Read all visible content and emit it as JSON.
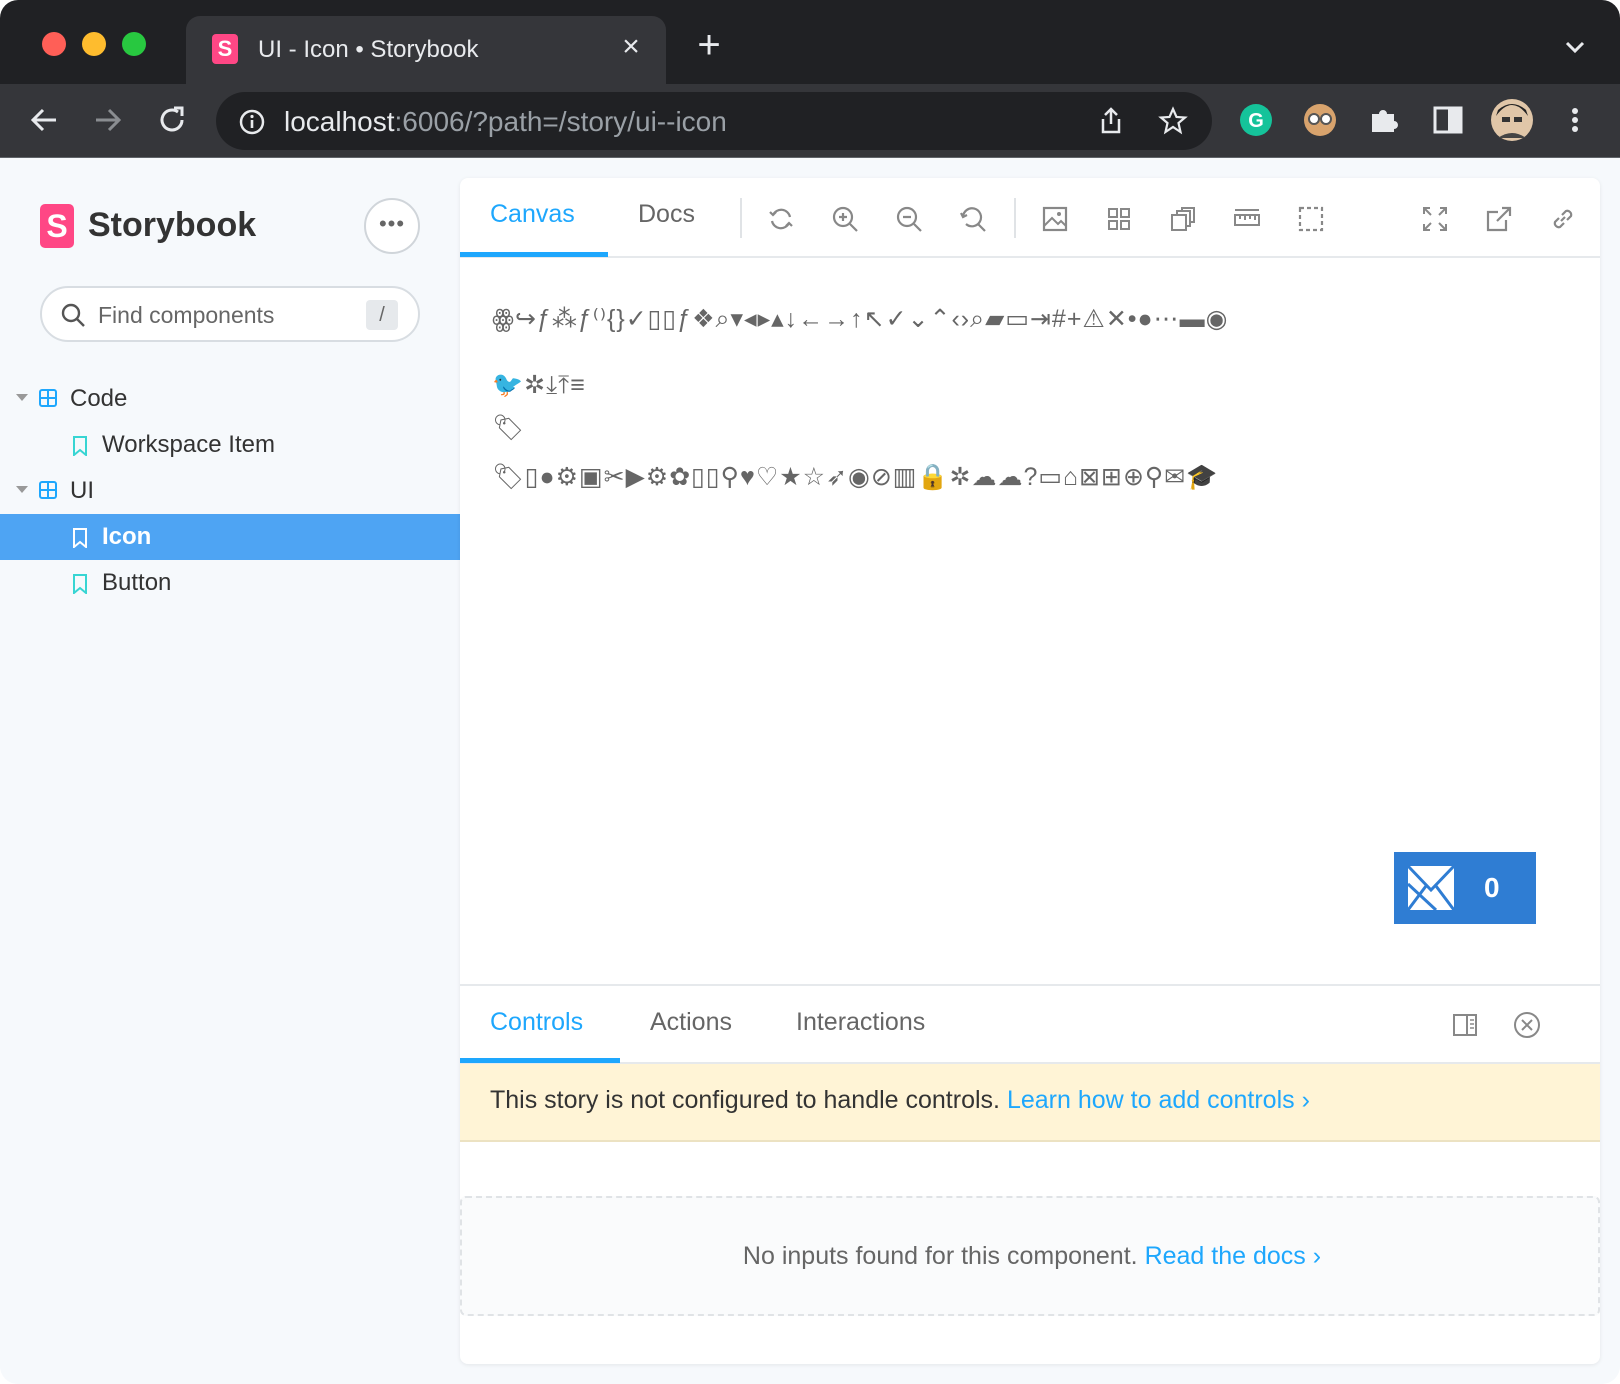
{
  "browser": {
    "tab_title": "UI - Icon • Storybook",
    "tab_favicon": "S",
    "new_tab": "+",
    "url_host": "localhost",
    "url_rest": ":6006/?path=/story/ui--icon"
  },
  "sidebar": {
    "logo_text": "Storybook",
    "logo_letter": "S",
    "menu_label": "•••",
    "search_placeholder": "Find components",
    "search_shortcut": "/",
    "tree": [
      {
        "label": "Code",
        "type": "group"
      },
      {
        "label": "Workspace Item",
        "type": "story"
      },
      {
        "label": "UI",
        "type": "group"
      },
      {
        "label": "Icon",
        "type": "story",
        "active": true
      },
      {
        "label": "Button",
        "type": "story"
      }
    ]
  },
  "main": {
    "tabs": {
      "canvas": "Canvas",
      "docs": "Docs"
    },
    "icon_rows": {
      "row1": "ꙮ↪ƒ⁂ƒ⁽⁾{}✓▯▯ƒ❖⌕▾◂▸▴↓←→↑↖✓⌄⌃‹›⌕▰▭⇥#+⚠✕•●⋯▬◉",
      "row2": "🐦✲⤓⤒≡",
      "row3": "🏷",
      "row4": "🏷▯●⚙▣✂▶⚙✿▯▯⚲♥♡★☆➶◉⊘▥🔒✲☁☁?▭⌂⊠⊞⊕⚲✉🎓"
    },
    "counter_value": "0"
  },
  "addons": {
    "tabs": {
      "controls": "Controls",
      "actions": "Actions",
      "interactions": "Interactions"
    },
    "notice_text": "This story is not configured to handle controls.",
    "notice_link": "Learn how to add controls",
    "notice_chevron": "›",
    "empty_text": "No inputs found for this component.",
    "empty_link": "Read the docs",
    "empty_chevron": "›"
  }
}
